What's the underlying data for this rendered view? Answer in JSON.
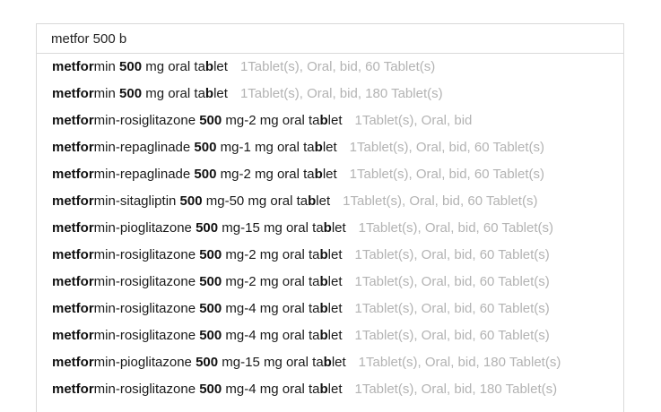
{
  "search": {
    "value": "metfor 500 b"
  },
  "suggestions": [
    {
      "parts": [
        {
          "text": "metfor",
          "bold": true
        },
        {
          "text": "min ",
          "bold": false
        },
        {
          "text": "500",
          "bold": true
        },
        {
          "text": " mg oral ta",
          "bold": false
        },
        {
          "text": "b",
          "bold": true
        },
        {
          "text": "let",
          "bold": false
        }
      ],
      "details": "1Tablet(s), Oral, bid, 60 Tablet(s)"
    },
    {
      "parts": [
        {
          "text": "metfor",
          "bold": true
        },
        {
          "text": "min ",
          "bold": false
        },
        {
          "text": "500",
          "bold": true
        },
        {
          "text": " mg oral ta",
          "bold": false
        },
        {
          "text": "b",
          "bold": true
        },
        {
          "text": "let",
          "bold": false
        }
      ],
      "details": "1Tablet(s), Oral, bid, 180 Tablet(s)"
    },
    {
      "parts": [
        {
          "text": "metfor",
          "bold": true
        },
        {
          "text": "min-rosiglitazone ",
          "bold": false
        },
        {
          "text": "500",
          "bold": true
        },
        {
          "text": " mg-2 mg oral ta",
          "bold": false
        },
        {
          "text": "b",
          "bold": true
        },
        {
          "text": "let",
          "bold": false
        }
      ],
      "details": "1Tablet(s), Oral, bid"
    },
    {
      "parts": [
        {
          "text": "metfor",
          "bold": true
        },
        {
          "text": "min-repaglinade ",
          "bold": false
        },
        {
          "text": "500",
          "bold": true
        },
        {
          "text": " mg-1 mg oral ta",
          "bold": false
        },
        {
          "text": "b",
          "bold": true
        },
        {
          "text": "let",
          "bold": false
        }
      ],
      "details": "1Tablet(s), Oral, bid, 60 Tablet(s)"
    },
    {
      "parts": [
        {
          "text": "metfor",
          "bold": true
        },
        {
          "text": "min-repaglinade ",
          "bold": false
        },
        {
          "text": "500",
          "bold": true
        },
        {
          "text": " mg-2 mg oral ta",
          "bold": false
        },
        {
          "text": "b",
          "bold": true
        },
        {
          "text": "let",
          "bold": false
        }
      ],
      "details": "1Tablet(s), Oral, bid, 60 Tablet(s)"
    },
    {
      "parts": [
        {
          "text": "metfor",
          "bold": true
        },
        {
          "text": "min-sitagliptin ",
          "bold": false
        },
        {
          "text": "500",
          "bold": true
        },
        {
          "text": " mg-50 mg oral ta",
          "bold": false
        },
        {
          "text": "b",
          "bold": true
        },
        {
          "text": "let",
          "bold": false
        }
      ],
      "details": "1Tablet(s), Oral, bid, 60 Tablet(s)"
    },
    {
      "parts": [
        {
          "text": "metfor",
          "bold": true
        },
        {
          "text": "min-pioglitazone ",
          "bold": false
        },
        {
          "text": "500",
          "bold": true
        },
        {
          "text": " mg-15 mg oral ta",
          "bold": false
        },
        {
          "text": "b",
          "bold": true
        },
        {
          "text": "let",
          "bold": false
        }
      ],
      "details": "1Tablet(s), Oral, bid, 60 Tablet(s)"
    },
    {
      "parts": [
        {
          "text": "metfor",
          "bold": true
        },
        {
          "text": "min-rosiglitazone ",
          "bold": false
        },
        {
          "text": "500",
          "bold": true
        },
        {
          "text": " mg-2 mg oral ta",
          "bold": false
        },
        {
          "text": "b",
          "bold": true
        },
        {
          "text": "let",
          "bold": false
        }
      ],
      "details": "1Tablet(s), Oral, bid, 60 Tablet(s)"
    },
    {
      "parts": [
        {
          "text": "metfor",
          "bold": true
        },
        {
          "text": "min-rosiglitazone ",
          "bold": false
        },
        {
          "text": "500",
          "bold": true
        },
        {
          "text": " mg-2 mg oral ta",
          "bold": false
        },
        {
          "text": "b",
          "bold": true
        },
        {
          "text": "let",
          "bold": false
        }
      ],
      "details": "1Tablet(s), Oral, bid, 60 Tablet(s)"
    },
    {
      "parts": [
        {
          "text": "metfor",
          "bold": true
        },
        {
          "text": "min-rosiglitazone ",
          "bold": false
        },
        {
          "text": "500",
          "bold": true
        },
        {
          "text": " mg-4 mg oral ta",
          "bold": false
        },
        {
          "text": "b",
          "bold": true
        },
        {
          "text": "let",
          "bold": false
        }
      ],
      "details": "1Tablet(s), Oral, bid, 60 Tablet(s)"
    },
    {
      "parts": [
        {
          "text": "metfor",
          "bold": true
        },
        {
          "text": "min-rosiglitazone ",
          "bold": false
        },
        {
          "text": "500",
          "bold": true
        },
        {
          "text": " mg-4 mg oral ta",
          "bold": false
        },
        {
          "text": "b",
          "bold": true
        },
        {
          "text": "let",
          "bold": false
        }
      ],
      "details": "1Tablet(s), Oral, bid, 60 Tablet(s)"
    },
    {
      "parts": [
        {
          "text": "metfor",
          "bold": true
        },
        {
          "text": "min-pioglitazone ",
          "bold": false
        },
        {
          "text": "500",
          "bold": true
        },
        {
          "text": " mg-15 mg oral ta",
          "bold": false
        },
        {
          "text": "b",
          "bold": true
        },
        {
          "text": "let",
          "bold": false
        }
      ],
      "details": "1Tablet(s), Oral, bid, 180 Tablet(s)"
    },
    {
      "parts": [
        {
          "text": "metfor",
          "bold": true
        },
        {
          "text": "min-rosiglitazone ",
          "bold": false
        },
        {
          "text": "500",
          "bold": true
        },
        {
          "text": " mg-4 mg oral ta",
          "bold": false
        },
        {
          "text": "b",
          "bold": true
        },
        {
          "text": "let",
          "bold": false
        }
      ],
      "details": "1Tablet(s), Oral, bid, 180 Tablet(s)"
    }
  ]
}
